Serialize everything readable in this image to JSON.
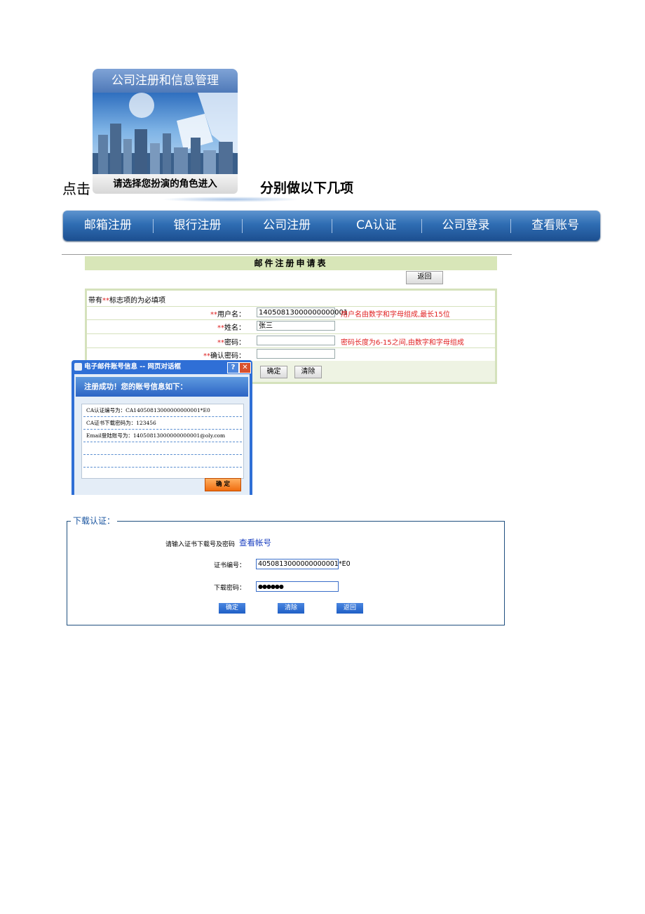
{
  "intro": {
    "prefix": "点击",
    "suffix": "分别做以下几项"
  },
  "banner": {
    "title": "公司注册和信息管理",
    "caption": "请选择您扮演的角色进入"
  },
  "nav": [
    "邮箱注册",
    "银行注册",
    "公司注册",
    "CA认证",
    "公司登录",
    "查看账号"
  ],
  "form": {
    "title": "邮件注册申请表",
    "back_label": "返回",
    "note_prefix": "带有",
    "note_stars": "**",
    "note_suffix": "标志项的为必填项",
    "fields": [
      {
        "stars": "**",
        "label": "用户名：",
        "value": "14050813000000000001",
        "hint": "用户名由数字和字母组成,最长15位"
      },
      {
        "stars": "**",
        "label": "姓名：",
        "value": "张三",
        "hint": ""
      },
      {
        "stars": "**",
        "label": "密码：",
        "value": "",
        "hint": "密码长度为6-15之间,由数字和字母组成"
      },
      {
        "stars": "**",
        "label": "确认密码：",
        "value": "",
        "hint": ""
      }
    ],
    "confirm_label": "确定",
    "clear_label": "清除"
  },
  "dialog": {
    "title": "电子邮件账号信息 -- 网页对话框",
    "help": "?",
    "close": "✕",
    "header": "注册成功！您的账号信息如下：",
    "lines": [
      "CA认证编号为：CA14050813000000000001*E0",
      "CA证书下载密码为：123456",
      "Email登陆账号为：14050813000000000001@oly.com",
      "",
      ""
    ],
    "ok_label": "确 定"
  },
  "download": {
    "legend": "下载认证：",
    "prompt": "请输入证书下载号及密码",
    "link": "查看帐号",
    "cert_label": "证书编号：",
    "cert_value": "4050813000000000001*E0",
    "pwd_label": "下载密码：",
    "pwd_value": "●●●●●●",
    "confirm": "确定",
    "clear": "清除",
    "back": "返回"
  },
  "colors": {
    "nav_blue": "#2f6db3",
    "title_green": "#d8e6b8",
    "required_red": "#d22222",
    "dialog_blue": "#2f6fd6"
  }
}
